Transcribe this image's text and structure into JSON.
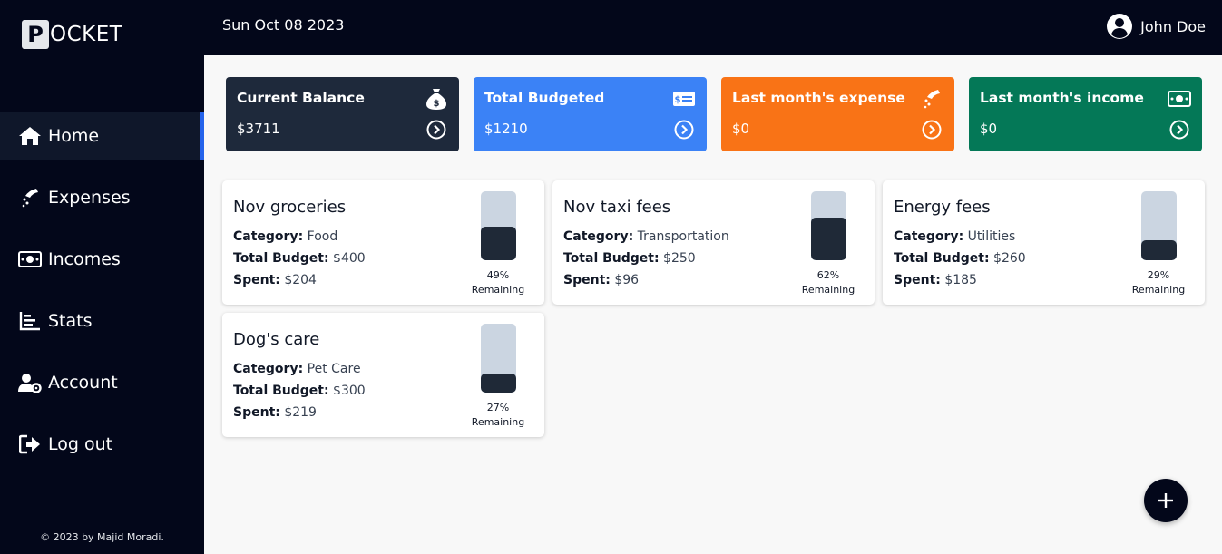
{
  "app": {
    "logo_letter": "P",
    "logo_rest": "OCKET"
  },
  "header": {
    "date": "Sun Oct 08 2023",
    "user_name": "John Doe"
  },
  "sidebar": {
    "items": [
      {
        "label": "Home",
        "icon": "home-icon",
        "active": true
      },
      {
        "label": "Expenses",
        "icon": "expense-icon",
        "active": false
      },
      {
        "label": "Incomes",
        "icon": "money-icon",
        "active": false
      },
      {
        "label": "Stats",
        "icon": "chart-icon",
        "active": false
      },
      {
        "label": "Account",
        "icon": "user-gear-icon",
        "active": false
      },
      {
        "label": "Log out",
        "icon": "logout-icon",
        "active": false
      }
    ],
    "footer": "© 2023 by Majid Moradi."
  },
  "summary": [
    {
      "title": "Current Balance",
      "value": "$3711",
      "color": "#1e293b",
      "icon": "money-bag-icon"
    },
    {
      "title": "Total Budgeted",
      "value": "$1210",
      "color": "#3b82f6",
      "icon": "budget-card-icon"
    },
    {
      "title": "Last month's expense",
      "value": "$0",
      "color": "#f97316",
      "icon": "expense-icon"
    },
    {
      "title": "Last month's income",
      "value": "$0",
      "color": "#047857",
      "icon": "money-icon"
    }
  ],
  "budgets": [
    {
      "name": "Nov groceries",
      "category_label": "Category:",
      "category": "Food",
      "budget_label": "Total Budget:",
      "budget": "$400",
      "spent_label": "Spent:",
      "spent": "$204",
      "remaining_pct": "49%",
      "remaining_label": "Remaining",
      "remaining_fraction": 0.49
    },
    {
      "name": "Nov taxi fees",
      "category_label": "Category:",
      "category": "Transportation",
      "budget_label": "Total Budget:",
      "budget": "$250",
      "spent_label": "Spent:",
      "spent": "$96",
      "remaining_pct": "62%",
      "remaining_label": "Remaining",
      "remaining_fraction": 0.62
    },
    {
      "name": "Energy fees",
      "category_label": "Category:",
      "category": "Utilities",
      "budget_label": "Total Budget:",
      "budget": "$260",
      "spent_label": "Spent:",
      "spent": "$185",
      "remaining_pct": "29%",
      "remaining_label": "Remaining",
      "remaining_fraction": 0.29
    },
    {
      "name": "Dog's care",
      "category_label": "Category:",
      "category": "Pet Care",
      "budget_label": "Total Budget:",
      "budget": "$300",
      "spent_label": "Spent:",
      "spent": "$219",
      "remaining_pct": "27%",
      "remaining_label": "Remaining",
      "remaining_fraction": 0.27
    }
  ],
  "fab": {
    "icon": "plus-icon"
  }
}
